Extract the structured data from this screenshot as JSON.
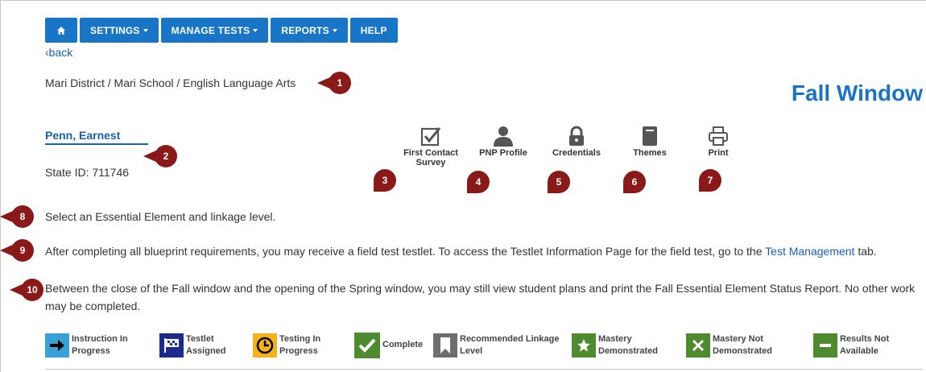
{
  "nav": {
    "home_icon": "home-icon",
    "settings": "SETTINGS",
    "manage_tests": "MANAGE TESTS",
    "reports": "REPORTS",
    "help": "HELP",
    "color": "#1976c6"
  },
  "back_link": "‹back",
  "breadcrumb": "Mari District / Mari School / English Language Arts",
  "window_title": "Fall Window",
  "student": {
    "name": "Penn, Earnest",
    "state_id": "State ID: 711746"
  },
  "tools": [
    {
      "label": "First Contact Survey",
      "icon": "checkbox-icon"
    },
    {
      "label": "PNP Profile",
      "icon": "person-icon"
    },
    {
      "label": "Credentials",
      "icon": "lock-icon"
    },
    {
      "label": "Themes",
      "icon": "book-icon"
    },
    {
      "label": "Print",
      "icon": "printer-icon"
    }
  ],
  "markers": [
    "1",
    "2",
    "3",
    "4",
    "5",
    "6",
    "7",
    "8",
    "9",
    "10"
  ],
  "instructions": {
    "select": "Select an Essential Element and linkage level.",
    "field_test_before": "After completing all blueprint requirements, you may receive a field test testlet. To access the Testlet Information Page for the field test, go to the",
    "field_test_link": "Test Management",
    "field_test_after": "tab.",
    "window_note": "Between the close of the Fall window and the opening of the Spring window, you may still view student plans and print the Fall Essential Element Status Report. No other work may be completed."
  },
  "legend": [
    {
      "line1": "Instruction In",
      "line2": "Progress",
      "color": "#3aa0d8",
      "icon": "arrow-right-icon"
    },
    {
      "line1": "Testlet",
      "line2": "Assigned",
      "color": "#1a2b8a",
      "icon": "flag-icon"
    },
    {
      "line1": "Testing In",
      "line2": "Progress",
      "color": "#f5b21b",
      "icon": "clock-icon"
    },
    {
      "line1": "Complete",
      "line2": "",
      "color": "#4e8a2e",
      "icon": "check-icon"
    },
    {
      "line1": "Recommended Linkage",
      "line2": "Level",
      "color": "#6e6e6e",
      "icon": "bookmark-icon"
    },
    {
      "line1": "Mastery",
      "line2": "Demonstrated",
      "color": "#4e8a2e",
      "icon": "star-icon"
    },
    {
      "line1": "Mastery Not",
      "line2": "Demonstrated",
      "color": "#4e8a2e",
      "icon": "x-icon"
    },
    {
      "line1": "Results Not",
      "line2": "Available",
      "color": "#4e8a2e",
      "icon": "minus-icon"
    }
  ]
}
